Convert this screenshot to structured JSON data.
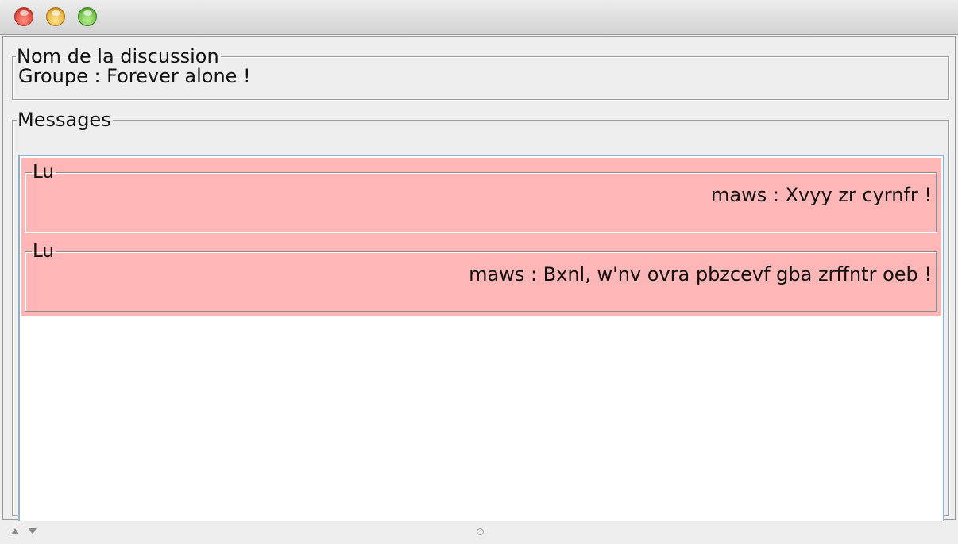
{
  "window": {
    "controls": {
      "close_icon": "close-icon",
      "minimize_icon": "minimize-icon",
      "maximize_icon": "maximize-icon"
    }
  },
  "discussion": {
    "legend": "Nom de la discussion",
    "name": "Groupe : Forever alone !"
  },
  "messages": {
    "legend": "Messages",
    "highlight_color": "#ffb6b6",
    "items": [
      {
        "status": "Lu",
        "text": "maws : Xvyy zr cyrnfr !"
      },
      {
        "status": "Lu",
        "text": "maws : Bxnl, w'nv ovra pbzcevf gba zrffntr oeb !"
      }
    ]
  },
  "statusbar": {
    "up_icon": "arrow-up-icon",
    "down_icon": "arrow-down-icon",
    "grip_icon": "resize-grip-icon"
  }
}
